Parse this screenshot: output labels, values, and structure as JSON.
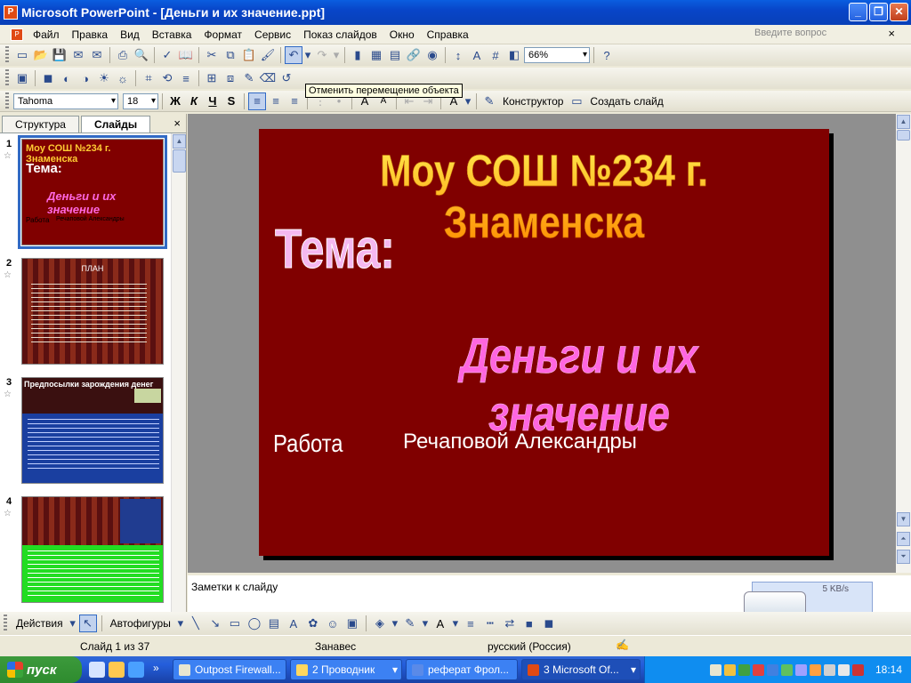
{
  "window": {
    "title": "Microsoft PowerPoint - [Деньги и их значение.ppt]",
    "btn_min": "_",
    "btn_max": "❐",
    "btn_close": "✕"
  },
  "menu": {
    "items": [
      "Файл",
      "Правка",
      "Вид",
      "Вставка",
      "Формат",
      "Сервис",
      "Показ слайдов",
      "Окно",
      "Справка"
    ],
    "help_placeholder": "Введите вопрос",
    "close": "×"
  },
  "toolbar": {
    "zoom": "66%",
    "font": "Tahoma",
    "font_size": "18",
    "bold": "Ж",
    "italic": "К",
    "underline": "Ч",
    "shadow": "S",
    "designer": "Конструктор",
    "new_slide": "Создать слайд"
  },
  "tooltip": "Отменить перемещение объекта",
  "panel": {
    "tab_outline": "Структура",
    "tab_slides": "Слайды",
    "close": "×"
  },
  "thumbs": [
    {
      "num": "1",
      "title": "Моу СОШ №234 г. Знаменска",
      "tema": "Тема:",
      "topic": "Деньги и их значение",
      "work": "Работа",
      "author": "Речаповой Александры"
    },
    {
      "num": "2",
      "title": "ПЛАН"
    },
    {
      "num": "3",
      "title": "Предпосылки зарождения денег"
    },
    {
      "num": "4"
    }
  ],
  "slide": {
    "title": "Моу СОШ №234 г. Знаменска",
    "tema": "Тема:",
    "topic": "Деньги и их значение",
    "work": "Работа",
    "author": "Речаповой Александры"
  },
  "notes": {
    "placeholder": "Заметки к слайду"
  },
  "net_widget": {
    "speed": "5 KB/s"
  },
  "drawbar": {
    "actions": "Действия",
    "autoshapes": "Автофигуры"
  },
  "status": {
    "slide": "Слайд 1 из 37",
    "design": "Занавес",
    "lang": "русский (Россия)"
  },
  "taskbar": {
    "start": "пуск",
    "tasks": [
      "Outpost Firewall...",
      "2 Проводник",
      "реферат Фрол...",
      "3 Microsoft Of..."
    ],
    "clock": "18:14"
  },
  "colors": {
    "slide_bg": "#800000",
    "accent": "#316ac5"
  }
}
